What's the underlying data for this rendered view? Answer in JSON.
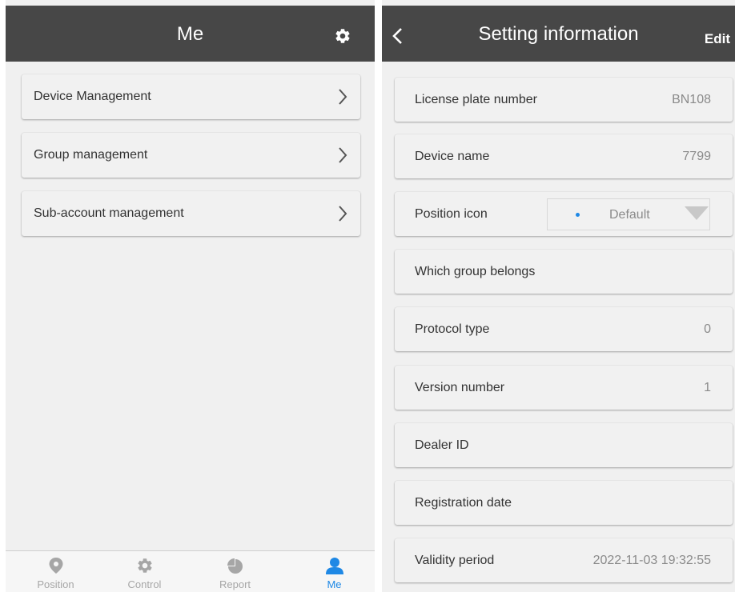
{
  "colors": {
    "appbar": "#474747",
    "accent": "#1e88e5",
    "background": "#f0f0f0",
    "inactive_tab": "#a6a6a6"
  },
  "left": {
    "header": {
      "title": "Me",
      "action_icon": "gear-icon"
    },
    "menu": [
      {
        "label": "Device Management"
      },
      {
        "label": "Group management"
      },
      {
        "label": "Sub-account management"
      }
    ],
    "tabs": [
      {
        "label": "Position",
        "icon": "location-pin-icon",
        "active": false
      },
      {
        "label": "Control",
        "icon": "gear-icon",
        "active": false
      },
      {
        "label": "Report",
        "icon": "pie-chart-icon",
        "active": false
      },
      {
        "label": "Me",
        "icon": "person-icon",
        "active": true
      }
    ]
  },
  "right": {
    "header": {
      "title": "Setting information",
      "back_icon": "back-arrow-icon",
      "edit_label": "Edit"
    },
    "fields": {
      "license_plate": {
        "label": "License plate number",
        "value": "BN108"
      },
      "device_name": {
        "label": "Device name",
        "value": "7799"
      },
      "position_icon": {
        "label": "Position icon",
        "value": "Default"
      },
      "group": {
        "label": "Which group belongs",
        "value": ""
      },
      "protocol_type": {
        "label": "Protocol type",
        "value": "0"
      },
      "version_number": {
        "label": "Version number",
        "value": "1"
      },
      "dealer_id": {
        "label": "Dealer ID",
        "value": ""
      },
      "registration_date": {
        "label": "Registration date",
        "value": ""
      },
      "validity_period": {
        "label": "Validity period",
        "value": "2022-11-03 19:32:55"
      }
    }
  }
}
